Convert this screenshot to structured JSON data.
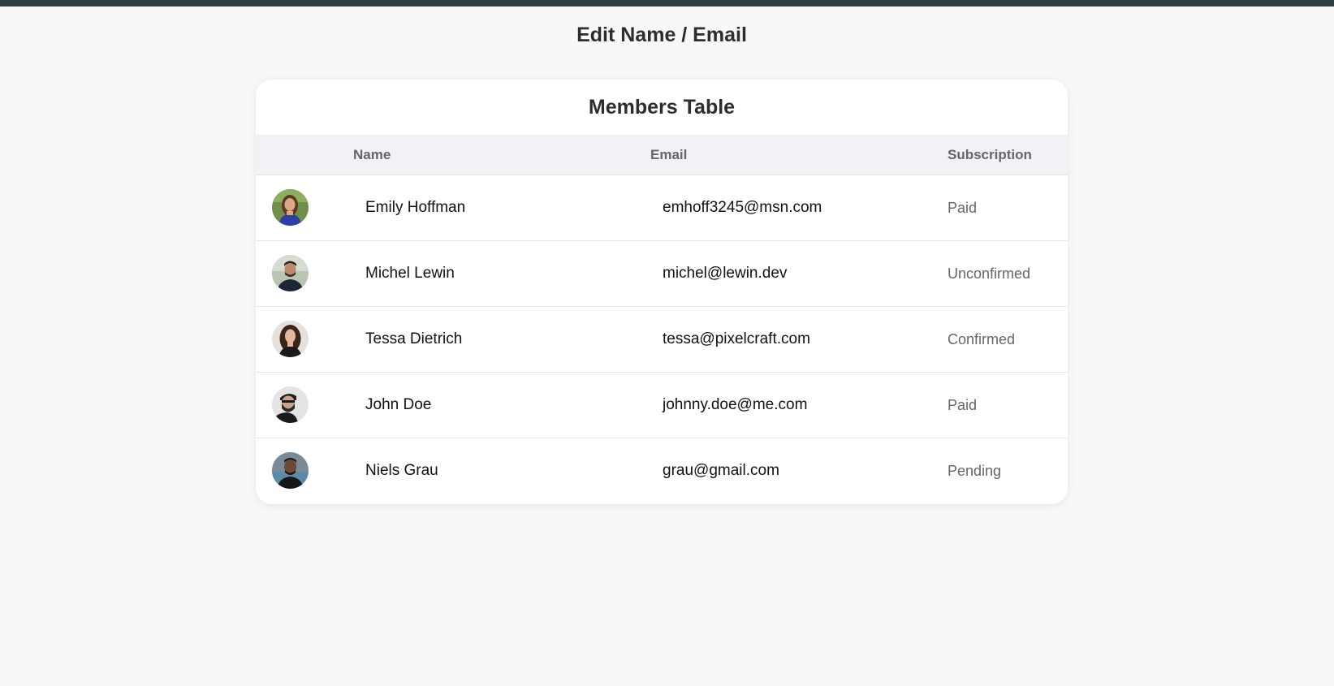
{
  "page": {
    "title": "Edit Name / Email"
  },
  "card": {
    "title": "Members Table",
    "columns": {
      "name": "Name",
      "email": "Email",
      "subscription": "Subscription"
    }
  },
  "members": [
    {
      "name": "Emily Hoffman",
      "email": "emhoff3245@msn.com",
      "subscription": "Paid",
      "avatar": "avatar-photo-emily"
    },
    {
      "name": "Michel Lewin",
      "email": "michel@lewin.dev",
      "subscription": "Unconfirmed",
      "avatar": "avatar-photo-michel"
    },
    {
      "name": "Tessa Dietrich",
      "email": "tessa@pixelcraft.com",
      "subscription": "Confirmed",
      "avatar": "avatar-photo-tessa"
    },
    {
      "name": "John Doe",
      "email": "johnny.doe@me.com",
      "subscription": "Paid",
      "avatar": "avatar-photo-john"
    },
    {
      "name": "Niels Grau",
      "email": "grau@gmail.com",
      "subscription": "Pending",
      "avatar": "avatar-photo-niels"
    }
  ],
  "colors": {
    "top_bar": "#2b3f45",
    "background": "#f8f8f8",
    "header_bg": "#f2f2f6",
    "muted_text": "#666666"
  }
}
